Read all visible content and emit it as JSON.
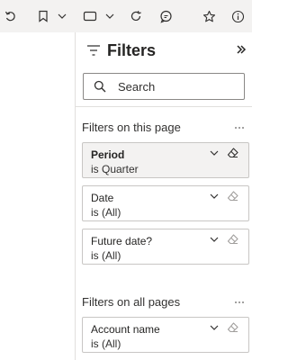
{
  "toolbar": {
    "icons": [
      "undo-icon",
      "bookmark-icon",
      "chevron-down-icon",
      "view-icon",
      "chevron-down-icon",
      "refresh-icon",
      "comment-icon",
      "favorite-star-icon",
      "info-icon"
    ]
  },
  "filter_pane": {
    "title": "Filters",
    "search": {
      "placeholder": "Search",
      "value": ""
    },
    "sections": [
      {
        "label": "Filters on this page",
        "cards": [
          {
            "title": "Period",
            "value": "is Quarter",
            "active": true
          },
          {
            "title": "Date",
            "value": "is (All)",
            "active": false
          },
          {
            "title": "Future date?",
            "value": "is (All)",
            "active": false
          }
        ]
      },
      {
        "label": "Filters on all pages",
        "cards": [
          {
            "title": "Account name",
            "value": "is (All)",
            "active": false
          }
        ]
      }
    ]
  },
  "colors": {
    "toolbar_bg": "#f3f2f1",
    "pane_bg": "#ffffff",
    "card_border": "#c8c6c4",
    "active_card_bg": "#f3f2f1",
    "text": "#252423"
  }
}
